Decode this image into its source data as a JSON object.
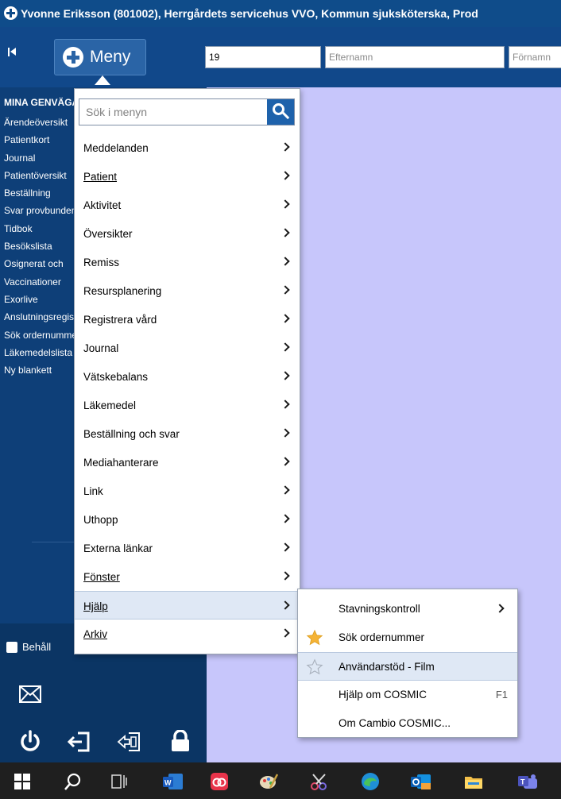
{
  "window": {
    "title": "Yvonne Eriksson (801002), Herrgårdets servicehus VVO, Kommun sjuksköterska, Prod"
  },
  "toolbar": {
    "menu_label": "Meny",
    "patient_id_value": "19",
    "lastname_placeholder": "Efternamn",
    "firstname_placeholder": "Förnamn"
  },
  "sidebar": {
    "header": "MINA GENVÄGAR",
    "items": [
      "Ärendeöversikt",
      "Patientkort",
      "Journal",
      "Patientöversikt",
      "Beställning",
      "Svar provbunden",
      "Tidbok",
      "Besökslista",
      "Osignerat och",
      "Vaccinationer",
      "Exorlive",
      "Anslutningsregister",
      "Sök ordernummer",
      "Läkemedelslista",
      "Ny blankett"
    ],
    "keep_label": "Behåll"
  },
  "menu": {
    "search_placeholder": "Sök i menyn",
    "items": [
      {
        "label": "Meddelanden"
      },
      {
        "label": "Patient"
      },
      {
        "label": "Aktivitet"
      },
      {
        "label": "Översikter"
      },
      {
        "label": "Remiss"
      },
      {
        "label": "Resursplanering"
      },
      {
        "label": "Registrera vård"
      },
      {
        "label": "Journal"
      },
      {
        "label": "Vätskebalans"
      },
      {
        "label": "Läkemedel"
      },
      {
        "label": "Beställning och svar"
      },
      {
        "label": "Mediahanterare"
      },
      {
        "label": "Link"
      },
      {
        "label": "Uthopp"
      },
      {
        "label": "Externa länkar"
      },
      {
        "label": "Fönster"
      },
      {
        "label": "Hjälp"
      },
      {
        "label": "Arkiv"
      }
    ]
  },
  "help_submenu": {
    "items": [
      {
        "label": "Stavningskontroll",
        "has_submenu": true
      },
      {
        "label": "Sök ordernummer",
        "icon": "star-filled-icon"
      },
      {
        "label": "Användarstöd - Film",
        "icon": "star-outline-icon"
      },
      {
        "label": "Hjälp om COSMIC",
        "shortcut": "F1"
      },
      {
        "label": "Om Cambio COSMIC..."
      }
    ]
  },
  "colors": {
    "titlebar": "#0f4c8a",
    "sidebar": "#0e3f78",
    "content_background": "#c7c6fb",
    "accent": "#1e62ab",
    "menu_highlight": "#dfe8f5"
  }
}
